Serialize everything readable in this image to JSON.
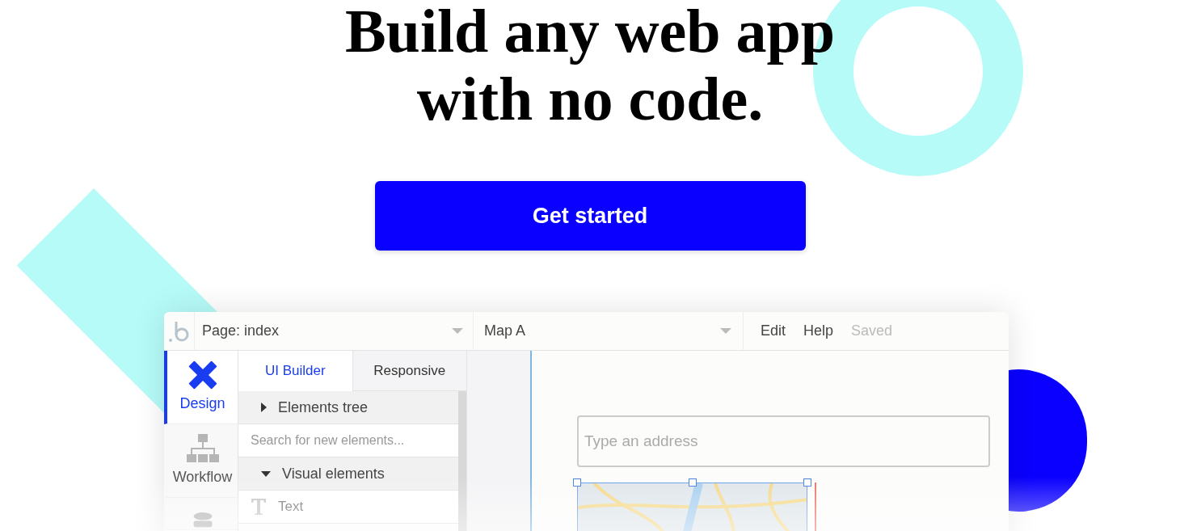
{
  "hero": {
    "title": "Build any web app with no code.",
    "cta": "Get started"
  },
  "editor": {
    "page_selector": "Page: index",
    "element_selector": "Map A",
    "menu": [
      "Edit",
      "Help"
    ],
    "save_status": "Saved",
    "rail": [
      {
        "label": "Design",
        "kind": "design",
        "selected": true
      },
      {
        "label": "Workflow",
        "kind": "workflow",
        "selected": false
      },
      {
        "kind": "data",
        "selected": false
      }
    ],
    "panel_tabs": [
      {
        "label": "UI Builder",
        "selected": true
      },
      {
        "label": "Responsive",
        "selected": false
      }
    ],
    "tree": [
      {
        "kind": "section",
        "label": "Elements tree",
        "expanded": false
      },
      {
        "kind": "search",
        "placeholder": "Search for new elements..."
      },
      {
        "kind": "section",
        "label": "Visual elements",
        "expanded": true
      },
      {
        "kind": "element",
        "label": "Text"
      }
    ],
    "canvas": {
      "address_placeholder": "Type an address"
    }
  }
}
